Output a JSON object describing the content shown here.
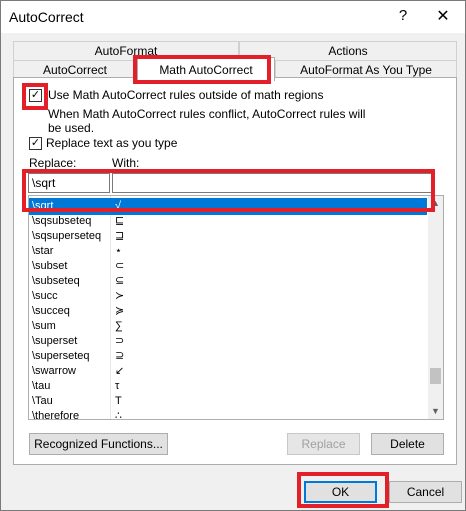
{
  "window": {
    "title": "AutoCorrect",
    "help_label": "?",
    "close_label": "✕"
  },
  "tabs": {
    "row1": [
      {
        "label": "AutoFormat"
      },
      {
        "label": "Actions"
      }
    ],
    "row2": [
      {
        "label": "AutoCorrect"
      },
      {
        "label": "Math AutoCorrect",
        "active": true
      },
      {
        "label": "AutoFormat As You Type"
      }
    ]
  },
  "options": {
    "use_outside_math": {
      "label": "Use Math AutoCorrect rules outside of math regions",
      "checked": true
    },
    "conflict_note_line1": "When Math AutoCorrect rules conflict, AutoCorrect rules will",
    "conflict_note_line2": "be used.",
    "replace_as_you_type": {
      "label": "Replace text as you type",
      "checked": true
    }
  },
  "replace": {
    "replace_label": "Replace:",
    "with_label": "With:",
    "replace_value": "\\sqrt",
    "with_value": ""
  },
  "list": {
    "rows": [
      {
        "replace": "\\sqrt",
        "with": "√",
        "selected": true
      },
      {
        "replace": "\\sqsubseteq",
        "with": "⊑"
      },
      {
        "replace": "\\sqsuperseteq",
        "with": "⊒"
      },
      {
        "replace": "\\star",
        "with": "⋆"
      },
      {
        "replace": "\\subset",
        "with": "⊂"
      },
      {
        "replace": "\\subseteq",
        "with": "⊆"
      },
      {
        "replace": "\\succ",
        "with": "≻"
      },
      {
        "replace": "\\succeq",
        "with": "≽"
      },
      {
        "replace": "\\sum",
        "with": "∑"
      },
      {
        "replace": "\\superset",
        "with": "⊃"
      },
      {
        "replace": "\\superseteq",
        "with": "⊇"
      },
      {
        "replace": "\\swarrow",
        "with": "↙"
      },
      {
        "replace": "\\tau",
        "with": "τ"
      },
      {
        "replace": "\\Tau",
        "with": "Τ"
      },
      {
        "replace": "\\therefore",
        "with": "∴"
      }
    ],
    "scroll_up_icon": "▲",
    "scroll_down_icon": "▼"
  },
  "buttons": {
    "recognized_functions": "Recognized Functions...",
    "replace": "Replace",
    "delete": "Delete",
    "ok": "OK",
    "cancel": "Cancel"
  },
  "colors": {
    "highlight": "#e3202a",
    "selection": "#0078d7"
  }
}
